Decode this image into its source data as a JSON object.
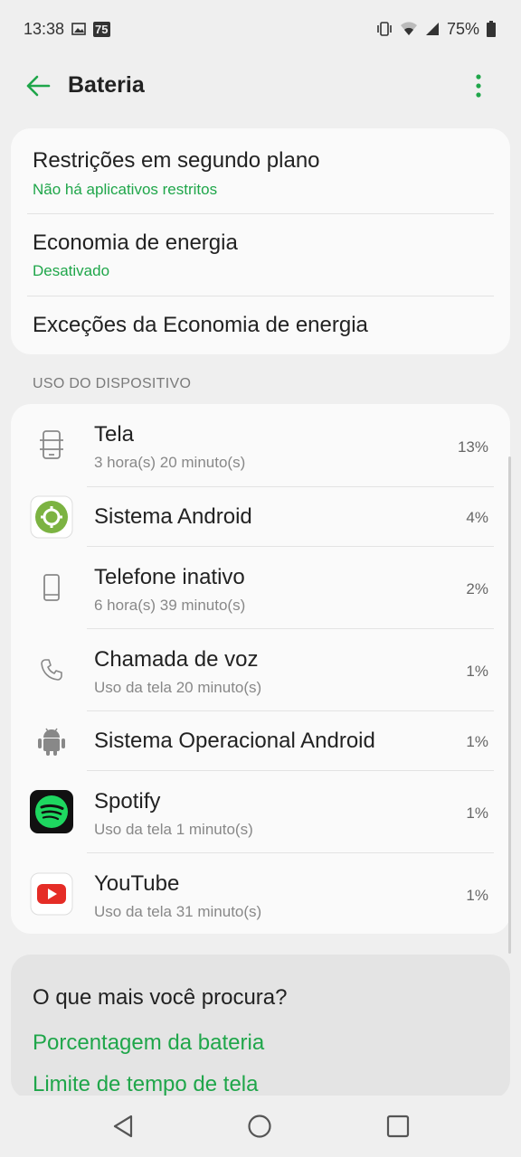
{
  "status_bar": {
    "time": "13:38",
    "badge": "75",
    "battery_percent": "75%"
  },
  "app_bar": {
    "title": "Bateria"
  },
  "settings": [
    {
      "title": "Restrições em segundo plano",
      "subtitle": "Não há aplicativos restritos"
    },
    {
      "title": "Economia de energia",
      "subtitle": "Desativado"
    },
    {
      "title": "Exceções da Economia de energia",
      "subtitle": ""
    }
  ],
  "usage": {
    "header": "USO DO DISPOSITIVO",
    "items": [
      {
        "name": "Tela",
        "detail": "3 hora(s) 20 minuto(s)",
        "percent": "13%",
        "icon": "screen-icon"
      },
      {
        "name": "Sistema Android",
        "detail": "",
        "percent": "4%",
        "icon": "android-system-settings-icon"
      },
      {
        "name": "Telefone inativo",
        "detail": "6 hora(s) 39 minuto(s)",
        "percent": "2%",
        "icon": "phone-idle-icon"
      },
      {
        "name": "Chamada de voz",
        "detail": "Uso da tela 20 minuto(s)",
        "percent": "1%",
        "icon": "phone-call-icon"
      },
      {
        "name": "Sistema Operacional Android",
        "detail": "",
        "percent": "1%",
        "icon": "android-robot-icon"
      },
      {
        "name": "Spotify",
        "detail": "Uso da tela 1 minuto(s)",
        "percent": "1%",
        "icon": "spotify-icon"
      },
      {
        "name": "YouTube",
        "detail": "Uso da tela 31 minuto(s)",
        "percent": "1%",
        "icon": "youtube-icon"
      }
    ]
  },
  "more": {
    "title": "O que mais você procura?",
    "links": [
      "Porcentagem da bateria",
      "Limite de tempo de tela"
    ]
  },
  "colors": {
    "accent": "#1fa64a",
    "background": "#efefef",
    "card": "#fafafa"
  }
}
